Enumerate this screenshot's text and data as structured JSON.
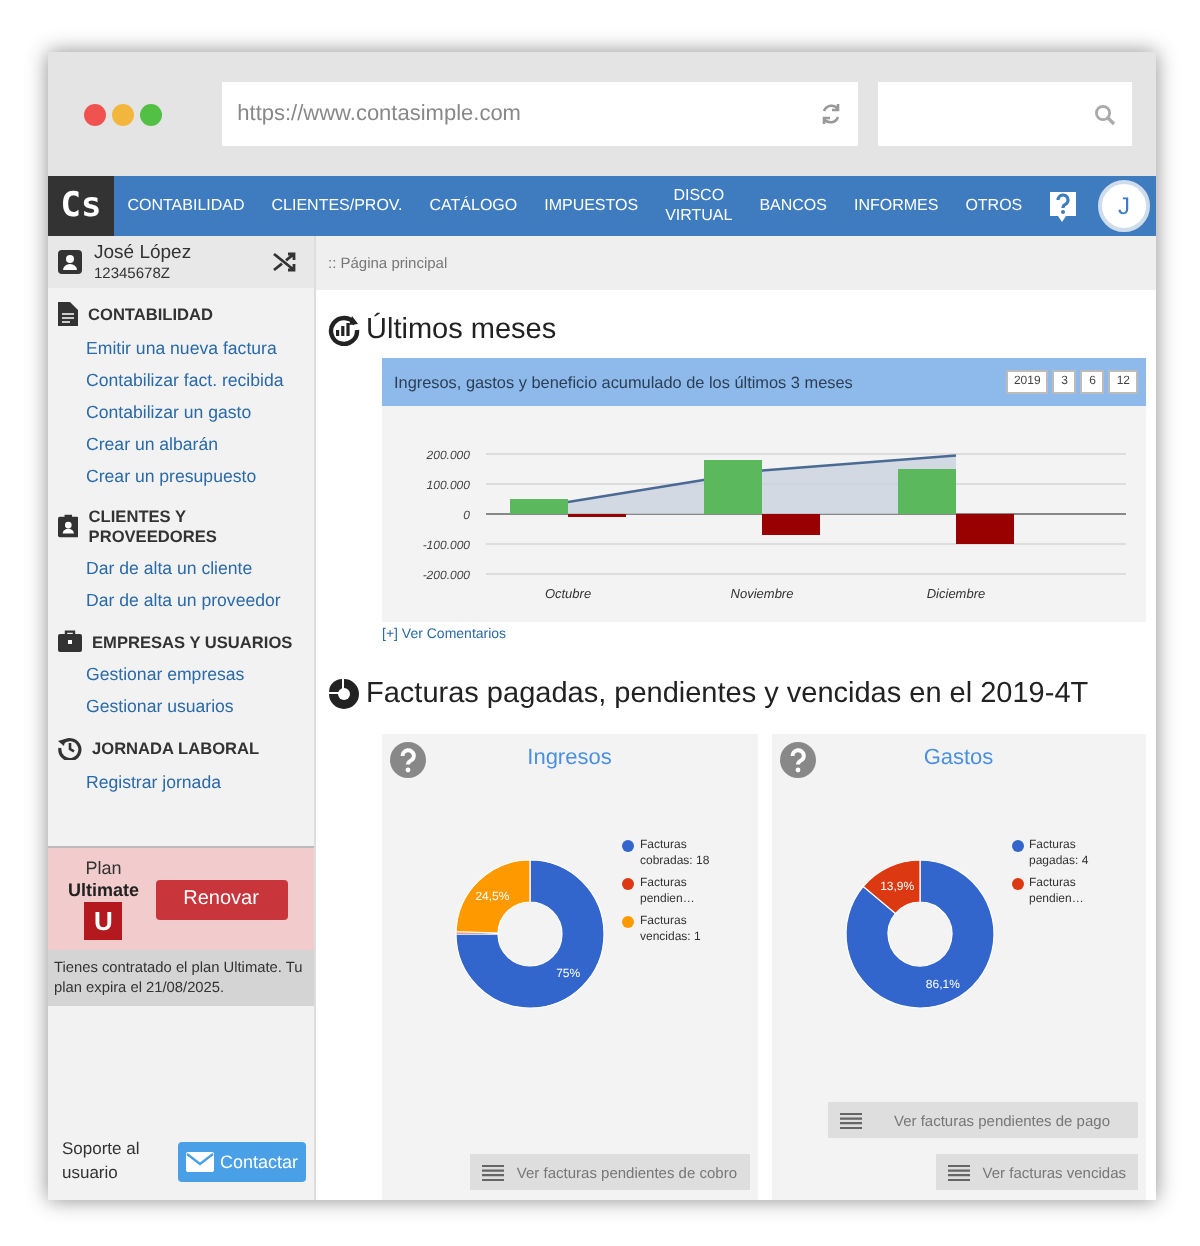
{
  "browser": {
    "url": "https://www.contasimple.com"
  },
  "nav": {
    "logo": "Cs",
    "items": [
      "CONTABILIDAD",
      "CLIENTES/PROV.",
      "CATÁLOGO",
      "IMPUESTOS",
      "DISCO VIRTUAL",
      "BANCOS",
      "INFORMES",
      "OTROS"
    ],
    "avatar": "J"
  },
  "user": {
    "name": "José López",
    "id": "12345678Z"
  },
  "sidebar": {
    "sections": [
      {
        "title": "CONTABILIDAD",
        "links": [
          "Emitir una nueva factura",
          "Contabilizar fact. recibida",
          "Contabilizar un gasto",
          "Crear un albarán",
          "Crear un presupuesto"
        ]
      },
      {
        "title": "CLIENTES Y PROVEEDORES",
        "links": [
          "Dar de alta un cliente",
          "Dar de alta un proveedor"
        ]
      },
      {
        "title": "EMPRESAS Y USUARIOS",
        "links": [
          "Gestionar empresas",
          "Gestionar usuarios"
        ]
      },
      {
        "title": "JORNADA LABORAL",
        "links": [
          "Registrar jornada"
        ]
      }
    ]
  },
  "plan": {
    "label": "Plan",
    "name": "Ultimate",
    "badge": "U",
    "button": "Renovar",
    "note": "Tienes contratado el plan Ultimate. Tu plan expira el 21/08/2025."
  },
  "support": {
    "label": "Soporte al usuario",
    "button": "Contactar"
  },
  "breadcrumb": ":: Página principal",
  "recent": {
    "heading": "Últimos meses",
    "card_title": "Ingresos, gastos y beneficio acumulado de los últimos 3 meses",
    "periods": [
      "2019",
      "3",
      "6",
      "12"
    ],
    "chart_data": {
      "type": "bar",
      "categories": [
        "Octubre",
        "Noviembre",
        "Diciembre"
      ],
      "series": [
        {
          "type": "bar",
          "color": "#5cb85c",
          "values": [
            50000,
            180000,
            150000
          ]
        },
        {
          "type": "bar",
          "color": "#990000",
          "values": [
            -10000,
            -70000,
            -100000
          ]
        },
        {
          "type": "line",
          "color": "#4a6a94",
          "values": [
            40000,
            145000,
            195000
          ]
        }
      ],
      "stacked": false,
      "ylim": [
        -200000,
        200000
      ],
      "yticks": [
        {
          "value": 200000,
          "label": "200.000"
        },
        {
          "value": 100000,
          "label": "100.000"
        },
        {
          "value": 0,
          "label": "0"
        },
        {
          "value": -100000,
          "label": "-100.000"
        },
        {
          "value": -200000,
          "label": "-200.000"
        }
      ]
    },
    "comments_link": "[+] Ver Comentarios"
  },
  "invoices": {
    "heading": "Facturas pagadas, pendientes y vencidas en el 2019-4T",
    "panels": [
      {
        "title": "Ingresos",
        "legend": [
          {
            "label": "Facturas cobradas: 18",
            "color": "#3366cc"
          },
          {
            "label": "Facturas pendien…",
            "color": "#dc3912"
          },
          {
            "label": "Facturas vencidas: 1",
            "color": "#ff9900"
          }
        ],
        "chart_data": {
          "type": "donut",
          "values": [
            75,
            0.5,
            24.5
          ],
          "value_labels": [
            "75%",
            null,
            "24,5%"
          ]
        },
        "buttons": [
          "Ver facturas pendientes de cobro"
        ]
      },
      {
        "title": "Gastos",
        "legend": [
          {
            "label": "Facturas pagadas: 4",
            "color": "#3366cc"
          },
          {
            "label": "Facturas pendien…",
            "color": "#dc3912"
          }
        ],
        "chart_data": {
          "type": "donut",
          "values": [
            86.1,
            13.9
          ],
          "value_labels": [
            "86,1%",
            "13,9%"
          ]
        },
        "buttons": [
          "Ver facturas pendientes de pago",
          "Ver facturas vencidas"
        ]
      }
    ]
  }
}
